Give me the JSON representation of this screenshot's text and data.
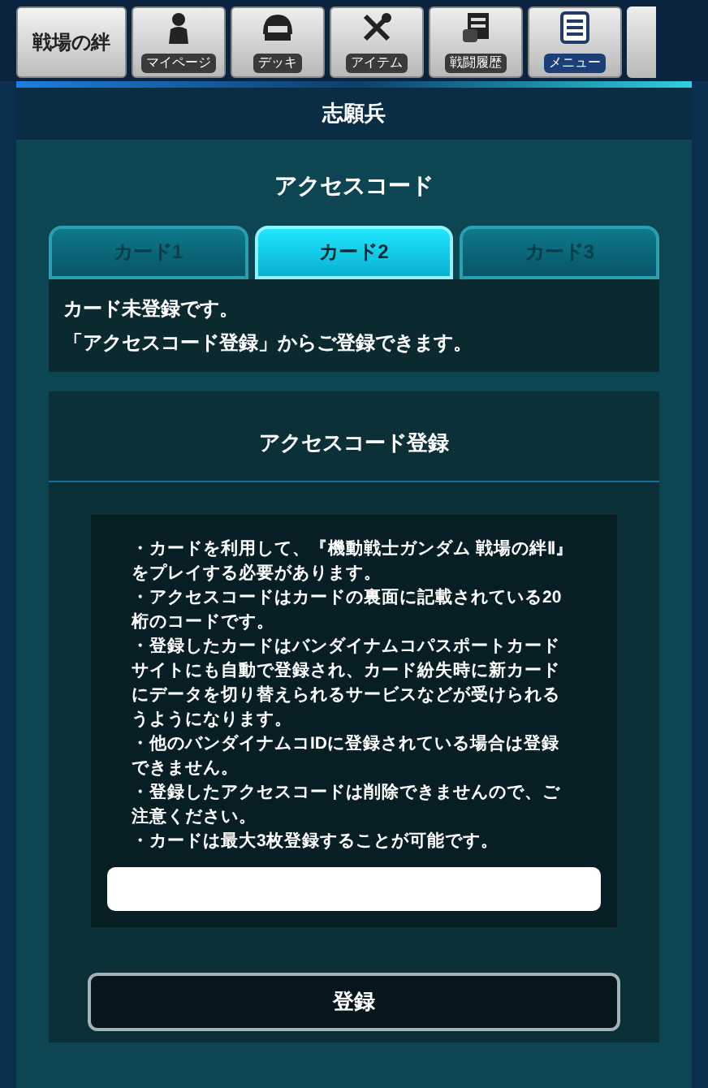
{
  "nav": {
    "logo_text": "戦場の絆",
    "items": [
      {
        "label": "マイページ",
        "selected": false
      },
      {
        "label": "デッキ",
        "selected": false
      },
      {
        "label": "アイテム",
        "selected": false
      },
      {
        "label": "戦闘履歴",
        "selected": false
      },
      {
        "label": "メニュー",
        "selected": true
      }
    ]
  },
  "rank": "志願兵",
  "page_title": "アクセスコード",
  "tabs": [
    {
      "label": "カード1",
      "selected": false
    },
    {
      "label": "カード2",
      "selected": true
    },
    {
      "label": "カード3",
      "selected": false
    }
  ],
  "message": [
    "カード未登録です。",
    "「アクセスコード登録」からご登録できます。"
  ],
  "panel": {
    "title": "アクセスコード登録",
    "notes": [
      "・カードを利用して、『機動戦士ガンダム 戦場の絆Ⅱ』をプレイする必要があります。",
      "・アクセスコードはカードの裏面に記載されている20桁のコードです。",
      "・登録したカードはバンダイナムコパスポートカードサイトにも自動で登録され、カード紛失時に新カードにデータを切り替えられるサービスなどが受けられるうようになります。",
      "・他のバンダイナムコIDに登録されている場合は登録できません。",
      "・登録したアクセスコードは削除できませんので、ご注意ください。",
      "・カードは最大3枚登録することが可能です。"
    ],
    "button": "登録"
  }
}
